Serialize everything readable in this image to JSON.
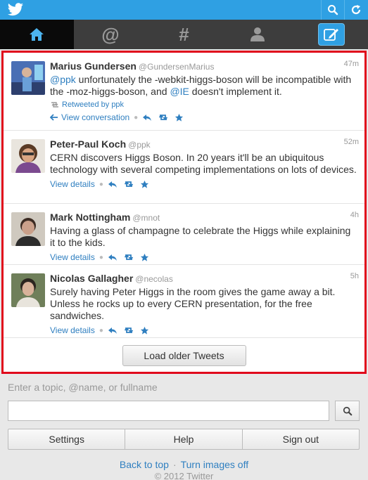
{
  "colors": {
    "brand": "#2fa0e3",
    "link": "#2f7fc0",
    "highlight_border": "#e0061b"
  },
  "nav": {
    "items": [
      {
        "icon": "home-icon",
        "active": true
      },
      {
        "icon": "at-mentions-icon",
        "label": "@"
      },
      {
        "icon": "hashtag-icon",
        "label": "#"
      },
      {
        "icon": "profile-icon"
      },
      {
        "icon": "compose-icon"
      }
    ]
  },
  "tweets": [
    {
      "name": "Marius Gundersen",
      "handle": "@GundersenMarius",
      "time": "47m",
      "text_parts": [
        "@ppk",
        " unfortunately the -webkit-higgs-boson will be incompatible with the -moz-higgs-boson, and ",
        "@IE",
        " doesn't implement it."
      ],
      "retweeted_by": "Retweeted by ppk",
      "action_link": "View conversation"
    },
    {
      "name": "Peter-Paul Koch",
      "handle": "@ppk",
      "time": "52m",
      "text": "CERN discovers Higgs Boson. In 20 years it'll be an ubiquitous technology with several competing implementations on lots of devices.",
      "action_link": "View details"
    },
    {
      "name": "Mark Nottingham",
      "handle": "@mnot",
      "time": "4h",
      "text": "Having a glass of champagne to celebrate the Higgs while explaining it to the kids.",
      "action_link": "View details"
    },
    {
      "name": "Nicolas Gallagher",
      "handle": "@necolas",
      "time": "5h",
      "text": "Surely having Peter Higgs in the room gives the game away a bit. Unless he rocks up to every CERN presentation, for the free sandwiches.",
      "action_link": "View details"
    }
  ],
  "load_more": "Load older Tweets",
  "search": {
    "hint": "Enter a topic, @name, or fullname",
    "value": ""
  },
  "footer": {
    "settings": "Settings",
    "help": "Help",
    "signout": "Sign out",
    "back_to_top": "Back to top",
    "separator": "·",
    "turn_images_off": "Turn images off",
    "copyright": "© 2012 Twitter"
  }
}
